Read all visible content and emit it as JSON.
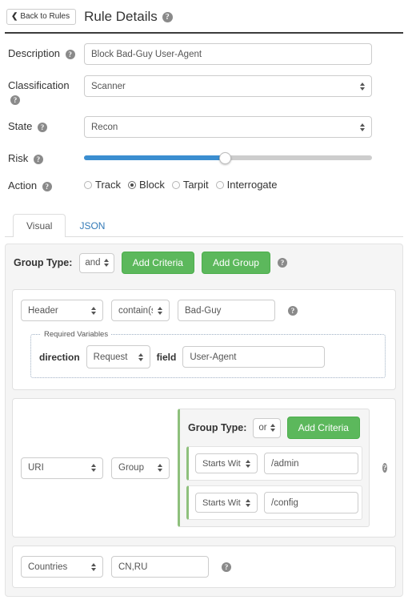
{
  "header": {
    "back_label": "Back to Rules",
    "back_chevron": "chevron-left-icon",
    "title": "Rule Details",
    "help_glyph": "?"
  },
  "form": {
    "description": {
      "label": "Description",
      "value": "Block Bad-Guy User-Agent"
    },
    "classification": {
      "label": "Classification",
      "value": "Scanner"
    },
    "state": {
      "label": "State",
      "value": "Recon"
    },
    "risk": {
      "label": "Risk",
      "percent": 49
    },
    "action": {
      "label": "Action",
      "options": [
        "Track",
        "Block",
        "Tarpit",
        "Interrogate"
      ],
      "selected": "Block"
    }
  },
  "tabs": [
    {
      "label": "Visual",
      "active": true
    },
    {
      "label": "JSON",
      "active": false
    }
  ],
  "builder": {
    "root_group": {
      "group_type_label": "Group Type:",
      "group_type_value": "and",
      "add_criteria_label": "Add Criteria",
      "add_group_label": "Add Group"
    },
    "criteria_1": {
      "field": "Header",
      "operator": "contain(s)",
      "value": "Bad-Guy",
      "required_variables": {
        "legend": "Required Variables",
        "direction_label": "direction",
        "direction_value": "Request",
        "field_label": "field",
        "field_value": "User-Agent"
      }
    },
    "criteria_2": {
      "field": "URI",
      "operator": "Group",
      "nested_group": {
        "group_type_label": "Group Type:",
        "group_type_value": "or",
        "add_criteria_label": "Add Criteria",
        "rows": [
          {
            "operator": "Starts With",
            "value": "/admin"
          },
          {
            "operator": "Starts With",
            "value": "/config"
          }
        ]
      }
    },
    "criteria_3": {
      "field": "Countries",
      "value": "CN,RU"
    }
  },
  "colors": {
    "accent_green": "#5cb85c",
    "slider_blue": "#3b8ed0",
    "link_blue": "#337ab7"
  }
}
